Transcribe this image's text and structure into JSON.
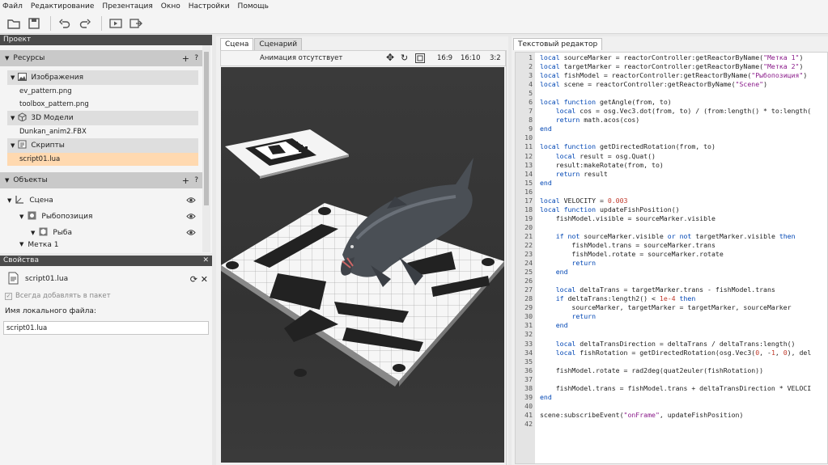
{
  "menu": [
    "Файл",
    "Редактирование",
    "Презентация",
    "Окно",
    "Настройки",
    "Помощь"
  ],
  "toolbar": {
    "icons": [
      "open-folder-icon",
      "save-icon",
      "undo-icon",
      "redo-icon",
      "play-icon",
      "export-icon"
    ]
  },
  "project": {
    "title": "Проект",
    "resources": {
      "label": "Ресурсы",
      "add": "+",
      "help": "?",
      "images": {
        "label": "Изображения",
        "files": [
          "ev_pattern.png",
          "toolbox_pattern.png"
        ]
      },
      "models": {
        "label": "3D Модели",
        "files": [
          "Dunkan_anim2.FBX"
        ]
      },
      "scripts": {
        "label": "Скрипты",
        "files": [
          "script01.lua"
        ]
      }
    },
    "objects": {
      "label": "Объекты",
      "add": "+",
      "help": "?",
      "items": [
        {
          "label": "Сцена",
          "level": 0
        },
        {
          "label": "Рыбопозиция",
          "level": 1
        },
        {
          "label": "Рыба",
          "level": 2
        },
        {
          "label": "Метка 1",
          "level": 1
        }
      ]
    }
  },
  "properties": {
    "title": "Свойства",
    "file": "script01.lua",
    "checkbox": "Всегда добавлять в пакет",
    "field_label": "Имя локального файла:",
    "field_value": "script01.lua"
  },
  "scene": {
    "tabs": [
      "Сцена",
      "Сценарий"
    ],
    "status": "Анимация отсутствует",
    "ratios": [
      "16:9",
      "16:10",
      "3:2"
    ]
  },
  "editor": {
    "tab": "Текстовый редактор",
    "lines": [
      "local sourceMarker = reactorController:getReactorByName(\"Метка 1\")",
      "local targetMarker = reactorController:getReactorByName(\"Метка 2\")",
      "local fishModel = reactorController:getReactorByName(\"Рыбопозиция\")",
      "local scene = reactorController:getReactorByName(\"Scene\")",
      "",
      "local function getAngle(from, to)",
      "    local cos = osg.Vec3.dot(from, to) / (from:length() * to:length(",
      "    return math.acos(cos)",
      "end",
      "",
      "local function getDirectedRotation(from, to)",
      "    local result = osg.Quat()",
      "    result:makeRotate(from, to)",
      "    return result",
      "end",
      "",
      "local VELOCITY = 0.003",
      "local function updateFishPosition()",
      "    fishModel.visible = sourceMarker.visible",
      "",
      "    if not sourceMarker.visible or not targetMarker.visible then",
      "        fishModel.trans = sourceMarker.trans",
      "        fishModel.rotate = sourceMarker.rotate",
      "        return",
      "    end",
      "",
      "    local deltaTrans = targetMarker.trans - fishModel.trans",
      "    if deltaTrans:length2() < 1e-4 then",
      "        sourceMarker, targetMarker = targetMarker, sourceMarker",
      "        return",
      "    end",
      "",
      "    local deltaTransDirection = deltaTrans / deltaTrans:length()",
      "    local fishRotation = getDirectedRotation(osg.Vec3(0, -1, 0), del",
      "",
      "    fishModel.rotate = rad2deg(quat2euler(fishRotation))",
      "",
      "    fishModel.trans = fishModel.trans + deltaTransDirection * VELOCI",
      "end",
      "",
      "scene:subscribeEvent(\"onFrame\", updateFishPosition)",
      ""
    ]
  },
  "colors": {
    "accent": "#ffd9b0",
    "header": "#4a4a4a",
    "keyword": "#0046b4",
    "string": "#8a1a8a",
    "number": "#c0392b"
  }
}
